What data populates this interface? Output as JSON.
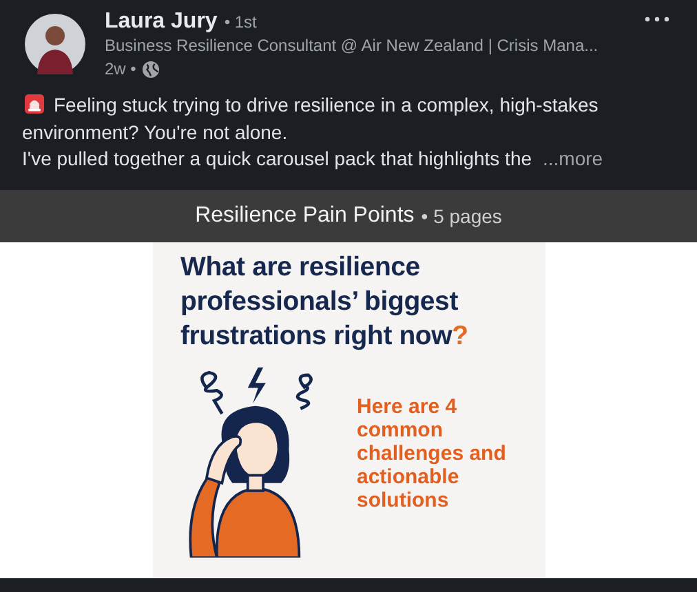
{
  "author": {
    "name": "Laura Jury",
    "degree": "• 1st",
    "headline": "Business Resilience Consultant @ Air New Zealand | Crisis Mana...",
    "time": "2w •"
  },
  "post": {
    "paragraphs": [
      "Feeling stuck trying to drive resilience in a complex, high-stakes environment? You're not alone.",
      "I've pulled together a quick carousel pack that highlights the"
    ],
    "more": "...more"
  },
  "document": {
    "title": "Resilience Pain Points",
    "pages": "• 5 pages",
    "slide": {
      "heading_lines": [
        "What are resilience",
        "professionals’ biggest",
        "frustrations right now"
      ],
      "heading_mark": "?",
      "subtext": "Here are 4 common challenges and actionable solutions"
    }
  }
}
